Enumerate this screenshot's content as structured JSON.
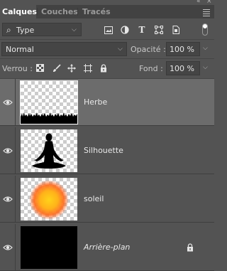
{
  "panel_controls": {
    "collapse": "«",
    "close": "×"
  },
  "tabs": [
    {
      "label": "Calques",
      "active": true
    },
    {
      "label": "Couches",
      "active": false
    },
    {
      "label": "Tracés",
      "active": false
    }
  ],
  "filter": {
    "kind_label": "Type",
    "icons": [
      "image-filter-icon",
      "adjustment-filter-icon",
      "type-filter-icon",
      "shape-filter-icon",
      "smart-object-filter-icon"
    ]
  },
  "blend": {
    "mode": "Normal",
    "opacity_label": "Opacité :",
    "opacity_value": "100 %"
  },
  "lock": {
    "label": "Verrou :",
    "icons": [
      "lock-transparent-pixels-icon",
      "lock-image-pixels-icon",
      "lock-position-icon",
      "lock-artboard-icon",
      "lock-all-icon"
    ],
    "fill_label": "Fond :",
    "fill_value": "100 %"
  },
  "layers": [
    {
      "name": "Herbe",
      "visible": true,
      "selected": true,
      "thumbnail": "grass-silhouette",
      "italic": false,
      "locked": false
    },
    {
      "name": "Silhouette",
      "visible": true,
      "selected": false,
      "thumbnail": "meditating-person-silhouette",
      "italic": false,
      "locked": false
    },
    {
      "name": "soleil",
      "visible": true,
      "selected": false,
      "thumbnail": "orange-sun-glow",
      "italic": false,
      "locked": false
    },
    {
      "name": "Arrière-plan",
      "visible": true,
      "selected": false,
      "thumbnail": "black-fill",
      "italic": true,
      "locked": true
    }
  ],
  "colors": {
    "panel_bg": "#535353",
    "selected_layer_bg": "#6c6c6c",
    "field_bg": "#454545",
    "sun_core": "#ffb21a",
    "sun_edge": "#ff5a1a"
  }
}
